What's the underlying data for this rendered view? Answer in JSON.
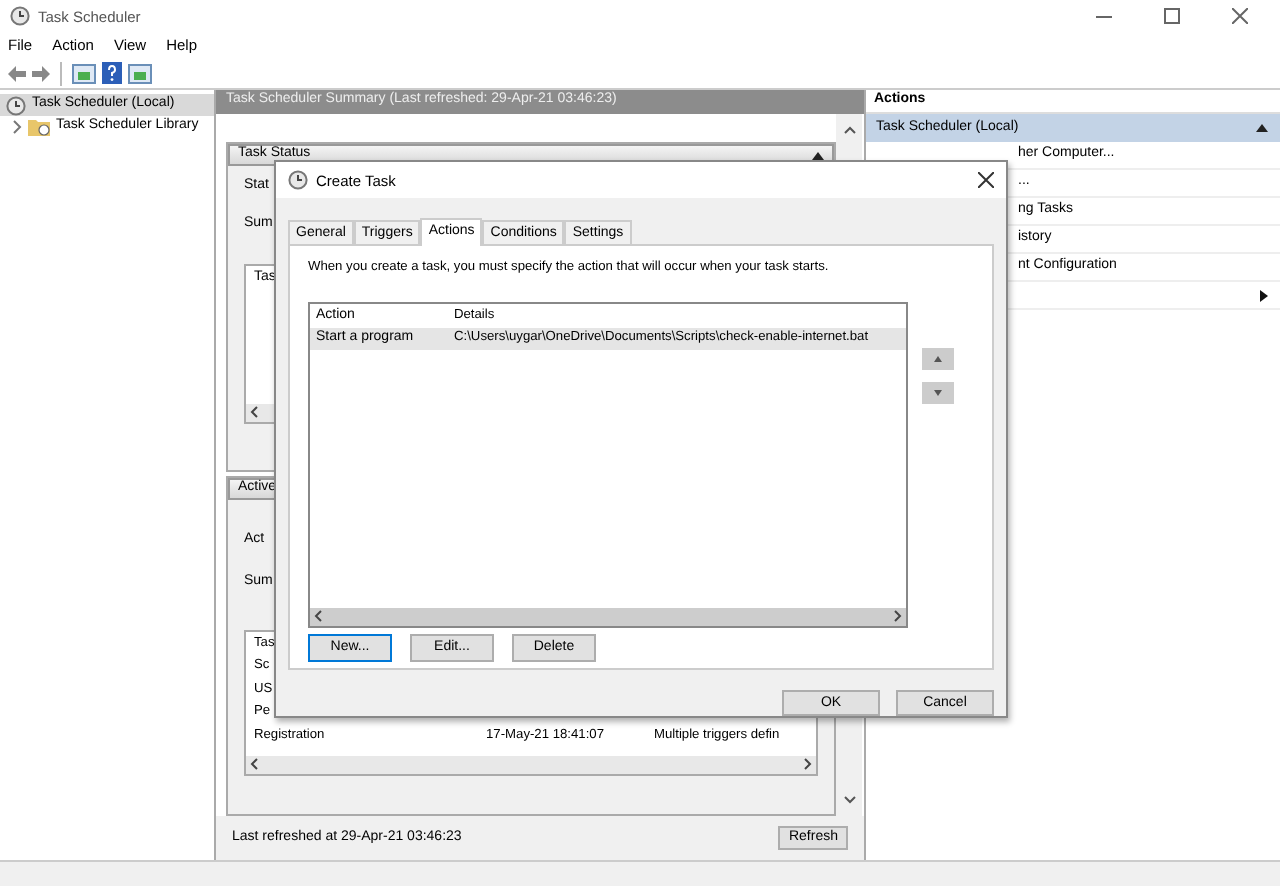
{
  "window": {
    "title": "Task Scheduler"
  },
  "menu": [
    "File",
    "Action",
    "View",
    "Help"
  ],
  "tree": [
    {
      "label": "Task Scheduler (Local)",
      "selected": true,
      "children": [
        {
          "label": "Task Scheduler Library",
          "selected": false,
          "expanded": false
        }
      ]
    }
  ],
  "summary": {
    "header": "Task Scheduler Summary (Last refreshed: 29-Apr-21 03:46:23)",
    "status_section": {
      "title": "Task Status",
      "expanded": true,
      "labels": [
        "Stat",
        "Sum"
      ],
      "box_heading": "Tas"
    },
    "active_section": {
      "title": "Active",
      "labels": [
        "Act",
        "Sum"
      ],
      "rows": [
        [
          "Tas"
        ],
        [
          "Sc"
        ],
        [
          "US"
        ],
        [
          "Pe"
        ],
        [
          "Registration",
          "17-May-21 18:41:07",
          "Multiple triggers defin"
        ]
      ]
    },
    "footer": {
      "text": "Last refreshed at 29-Apr-21 03:46:23",
      "button": "Refresh"
    }
  },
  "actions_pane": {
    "title": "Actions",
    "group": {
      "label": "Task Scheduler (Local)",
      "expanded": true
    },
    "items": [
      {
        "kind": "item",
        "label": "her Computer..."
      },
      {
        "kind": "item",
        "label": "..."
      },
      {
        "kind": "item",
        "label": "ng Tasks"
      },
      {
        "kind": "item",
        "label": "istory"
      },
      {
        "kind": "item",
        "label": "nt Configuration"
      },
      {
        "kind": "submenu"
      }
    ]
  },
  "dialog": {
    "title": "Create Task",
    "tabs": [
      {
        "label": "General",
        "selected": false
      },
      {
        "label": "Triggers",
        "selected": false
      },
      {
        "label": "Actions",
        "selected": true
      },
      {
        "label": "Conditions",
        "selected": false
      },
      {
        "label": "Settings",
        "selected": false
      }
    ],
    "description": "When you create a task, you must specify the action that will occur when your task starts.",
    "list": {
      "columns": [
        "Action",
        "Details"
      ],
      "rows": [
        {
          "cells": [
            "Start a program",
            "C:\\Users\\uygar\\OneDrive\\Documents\\Scripts\\check-enable-internet.bat"
          ],
          "selected": true
        }
      ]
    },
    "buttons": [
      {
        "label": "New...",
        "default": true
      },
      {
        "label": "Edit...",
        "default": false
      },
      {
        "label": "Delete",
        "default": false
      }
    ],
    "footer_buttons": [
      "OK",
      "Cancel"
    ]
  }
}
